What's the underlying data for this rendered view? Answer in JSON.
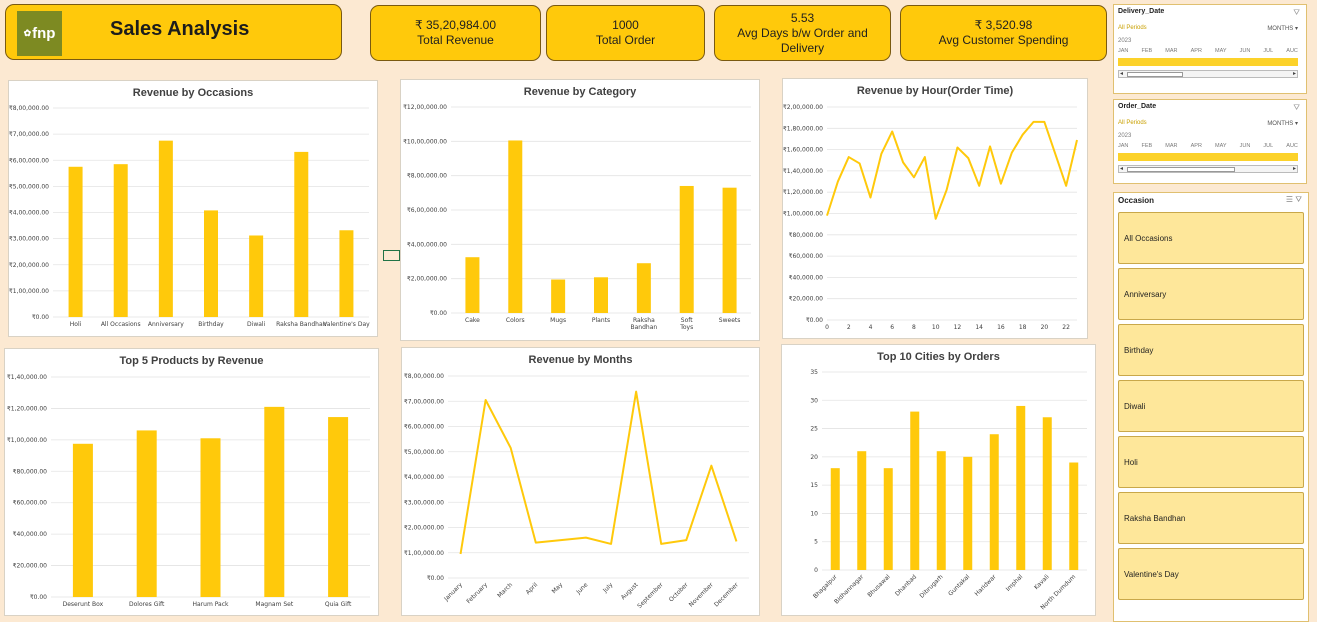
{
  "header": {
    "logo_text": "fnp",
    "title": "Sales Analysis"
  },
  "kpis": [
    {
      "value": "₹ 35,20,984.00",
      "label": "Total Revenue"
    },
    {
      "value": "1000",
      "label": "Total Order"
    },
    {
      "value": "5.53",
      "label": "Avg Days b/w Order and Delivery"
    },
    {
      "value": "₹ 3,520.98",
      "label": "Avg Customer Spending"
    }
  ],
  "colors": {
    "accent": "#ffc90b",
    "series": "#ffc90b",
    "background": "#fce9d2"
  },
  "chart_data": [
    {
      "id": "occ",
      "type": "bar",
      "title": "Revenue by Occasions",
      "categories": [
        "Holi",
        "All Occasions",
        "Anniversary",
        "Birthday",
        "Diwali",
        "Raksha Bandhan",
        "Valentine's Day"
      ],
      "values": [
        575000,
        585000,
        675000,
        408000,
        312000,
        632000,
        332000
      ],
      "ylim": [
        0,
        800000
      ],
      "yticks": [
        "₹0.00",
        "₹1,00,000.00",
        "₹2,00,000.00",
        "₹3,00,000.00",
        "₹4,00,000.00",
        "₹5,00,000.00",
        "₹6,00,000.00",
        "₹7,00,000.00",
        "₹8,00,000.00"
      ],
      "grid": true
    },
    {
      "id": "cat",
      "type": "bar",
      "title": "Revenue by Category",
      "categories": [
        "Cake",
        "Colors",
        "Mugs",
        "Plants",
        "Raksha Bandhan",
        "Soft Toys",
        "Sweets"
      ],
      "values": [
        325000,
        1005000,
        195000,
        208000,
        290000,
        740000,
        730000
      ],
      "ylim": [
        0,
        1200000
      ],
      "yticks": [
        "₹0.00",
        "₹2,00,000.00",
        "₹4,00,000.00",
        "₹6,00,000.00",
        "₹8,00,000.00",
        "₹10,00,000.00",
        "₹12,00,000.00"
      ],
      "grid": true
    },
    {
      "id": "hour",
      "type": "line",
      "title": "Revenue by Hour(Order Time)",
      "x": [
        0,
        1,
        2,
        3,
        4,
        5,
        6,
        7,
        8,
        9,
        10,
        11,
        12,
        13,
        14,
        15,
        16,
        17,
        18,
        19,
        20,
        21,
        22,
        23
      ],
      "values": [
        98000,
        130000,
        153000,
        147000,
        115000,
        156000,
        177000,
        148000,
        134000,
        153000,
        95000,
        122000,
        162000,
        152000,
        126000,
        163000,
        128000,
        157000,
        174000,
        186000,
        186000,
        156000,
        126000,
        169000
      ],
      "ylim": [
        0,
        200000
      ],
      "yticks": [
        "₹0.00",
        "₹20,000.00",
        "₹40,000.00",
        "₹60,000.00",
        "₹80,000.00",
        "₹1,00,000.00",
        "₹1,20,000.00",
        "₹1,40,000.00",
        "₹1,60,000.00",
        "₹1,80,000.00",
        "₹2,00,000.00"
      ],
      "xticks": [
        "0",
        "2",
        "4",
        "6",
        "8",
        "10",
        "12",
        "14",
        "16",
        "18",
        "20",
        "22"
      ],
      "grid": true
    },
    {
      "id": "prod",
      "type": "bar",
      "title": "Top 5 Products by Revenue",
      "categories": [
        "Deserunt Box",
        "Dolores Gift",
        "Harum Pack",
        "Magnam Set",
        "Quia Gift"
      ],
      "values": [
        97500,
        106000,
        101000,
        121000,
        114500
      ],
      "ylim": [
        0,
        140000
      ],
      "yticks": [
        "₹0.00",
        "₹20,000.00",
        "₹40,000.00",
        "₹60,000.00",
        "₹80,000.00",
        "₹1,00,000.00",
        "₹1,20,000.00",
        "₹1,40,000.00"
      ],
      "grid": true
    },
    {
      "id": "month",
      "type": "line",
      "title": "Revenue by  Months",
      "categories": [
        "January",
        "February",
        "March",
        "April",
        "May",
        "June",
        "July",
        "August",
        "September",
        "October",
        "November",
        "December"
      ],
      "values": [
        95000,
        705000,
        515000,
        140000,
        150000,
        160000,
        135000,
        738000,
        135000,
        150000,
        445000,
        145000
      ],
      "ylim": [
        0,
        800000
      ],
      "yticks": [
        "₹0.00",
        "₹1,00,000.00",
        "₹2,00,000.00",
        "₹3,00,000.00",
        "₹4,00,000.00",
        "₹5,00,000.00",
        "₹6,00,000.00",
        "₹7,00,000.00",
        "₹8,00,000.00"
      ],
      "grid": true
    },
    {
      "id": "city",
      "type": "bar",
      "title": "Top 10 Cities by Orders",
      "categories": [
        "Bhagalpur",
        "Bidhannagar",
        "Bhusawal",
        "Dhanbad",
        "Dibrugarh",
        "Guntakal",
        "Haridwar",
        "Imphal",
        "Kavali",
        "North Dumdum"
      ],
      "values": [
        18,
        21,
        18,
        28,
        21,
        20,
        24,
        29,
        27,
        19
      ],
      "ylim": [
        0,
        35
      ],
      "yticks": [
        "0",
        "5",
        "10",
        "15",
        "20",
        "25",
        "30",
        "35"
      ],
      "grid": true
    }
  ],
  "slicers": {
    "delivery": {
      "title": "Delivery_Date",
      "all_periods": "All Periods",
      "level": "MONTHS",
      "year": "2023",
      "months": [
        "JAN",
        "FEB",
        "MAR",
        "APR",
        "MAY",
        "JUN",
        "JUL",
        "AUC"
      ]
    },
    "order": {
      "title": "Order_Date",
      "all_periods": "All Periods",
      "level": "MONTHS",
      "year": "2023",
      "months": [
        "JAN",
        "FEB",
        "MAR",
        "APR",
        "MAY",
        "JUN",
        "JUL",
        "AUC"
      ]
    },
    "occasion": {
      "title": "Occasion",
      "items": [
        "All Occasions",
        "Anniversary",
        "Birthday",
        "Diwali",
        "Holi",
        "Raksha Bandhan",
        "Valentine's Day"
      ]
    }
  }
}
